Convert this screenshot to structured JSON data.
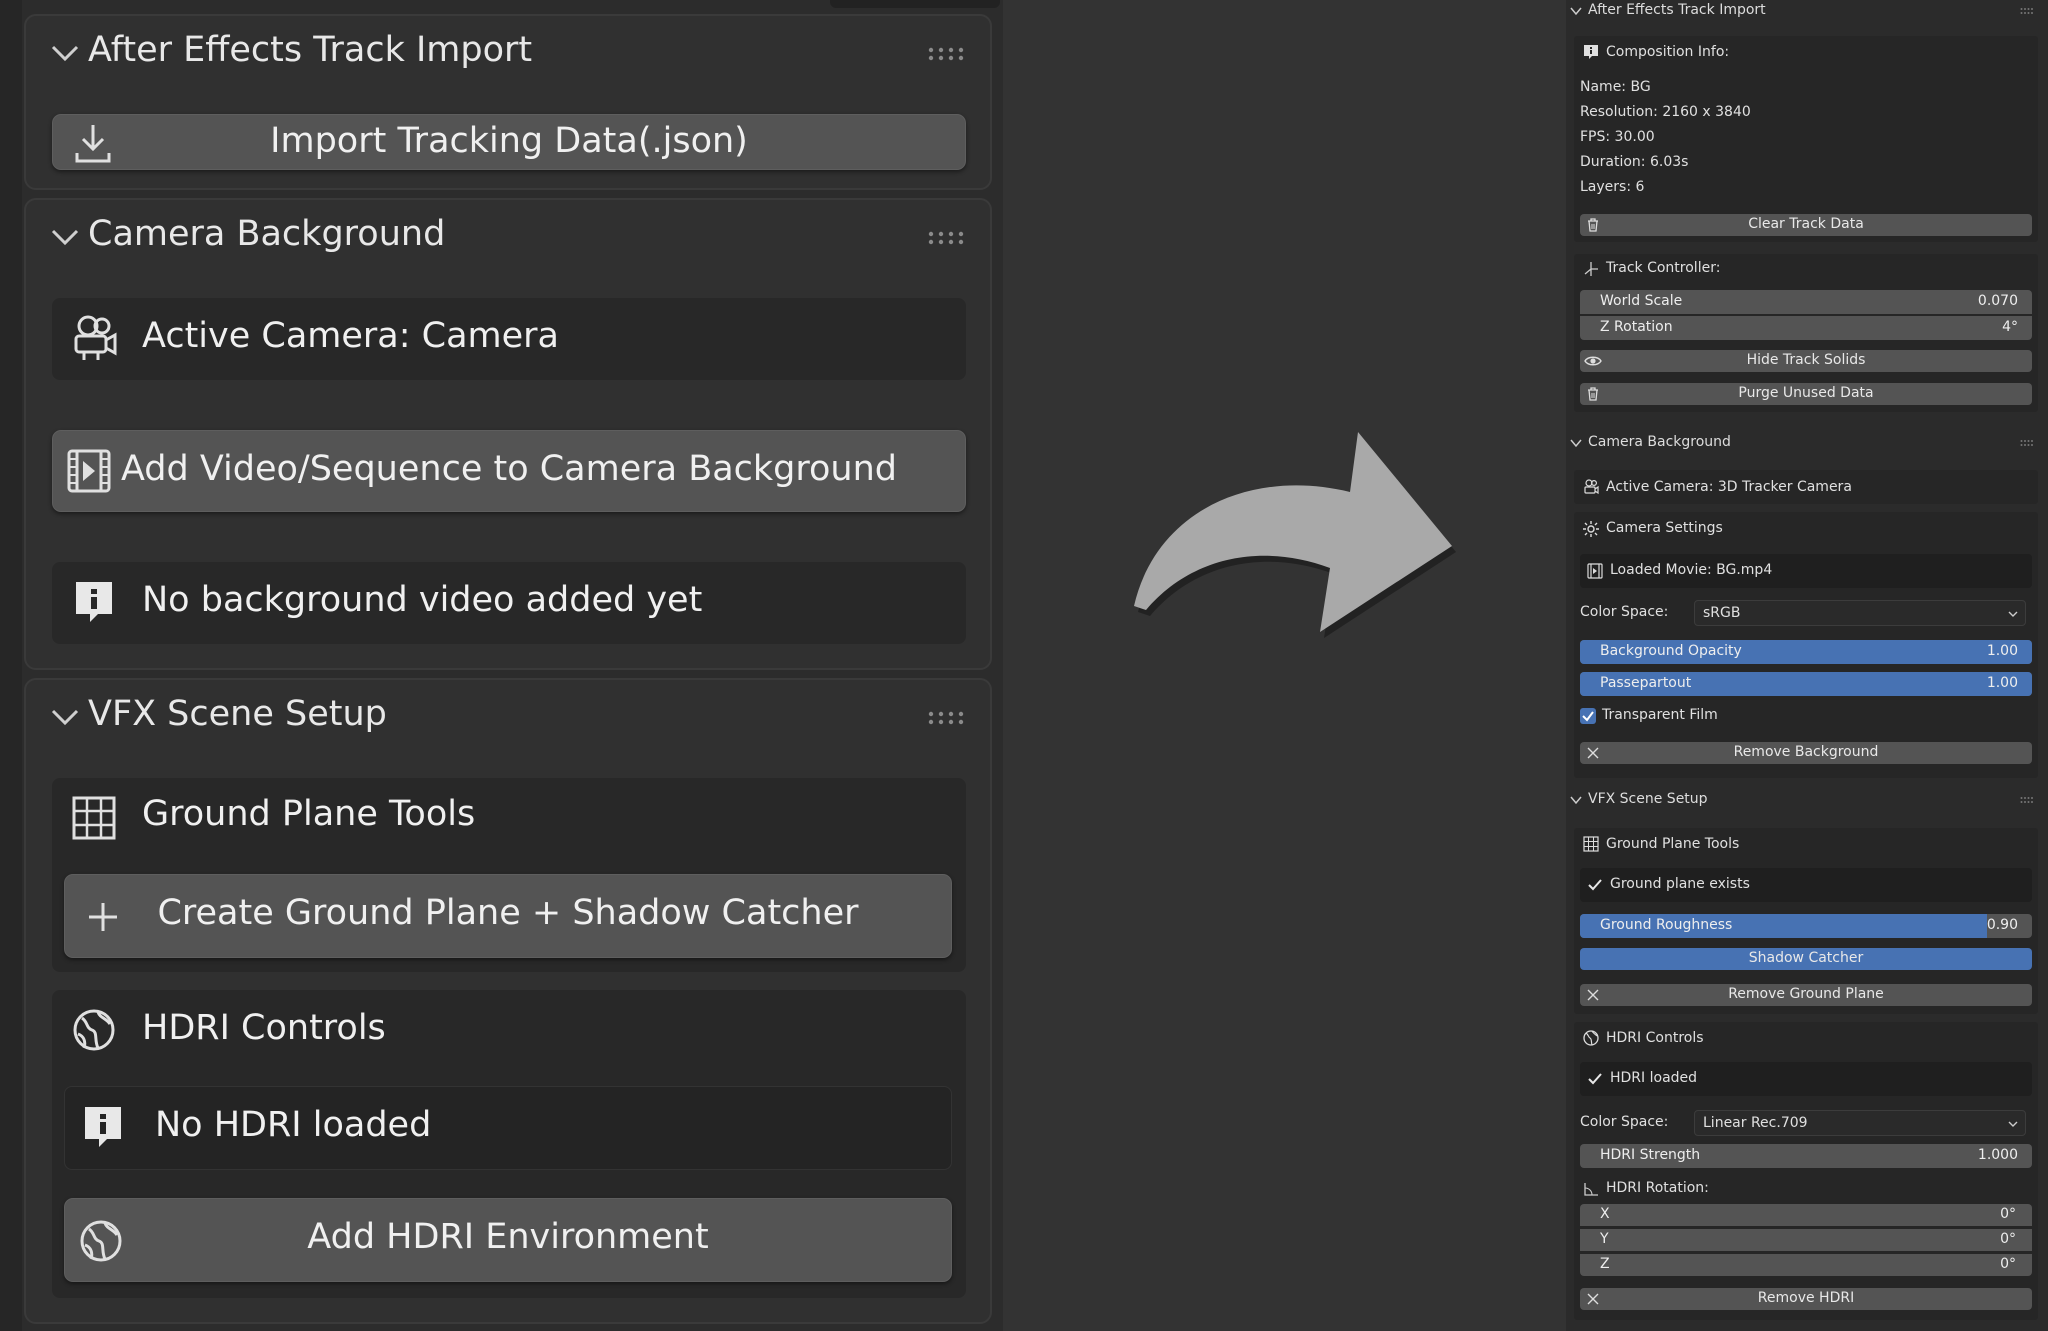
{
  "left": {
    "ae_panel": {
      "title": "After Effects Track Import",
      "import_label": "Import Tracking Data(.json)"
    },
    "cam_panel": {
      "title": "Camera Background",
      "active_camera": "Active Camera: Camera",
      "add_video_label": "Add Video/Sequence to Camera Background",
      "no_video": "No background video added yet"
    },
    "vfx_panel": {
      "title": "VFX Scene Setup",
      "ground_title": "Ground Plane Tools",
      "create_ground_label": "Create Ground Plane + Shadow Catcher",
      "hdri_title": "HDRI Controls",
      "no_hdri": "No HDRI loaded",
      "add_hdri_label": "Add HDRI Environment"
    }
  },
  "right": {
    "ae_panel": {
      "title": "After Effects Track Import",
      "comp_info_label": "Composition Info:",
      "name": "Name: BG",
      "resolution": "Resolution: 2160 x 3840",
      "fps": "FPS: 30.00",
      "duration": "Duration: 6.03s",
      "layers": "Layers: 6",
      "clear_label": "Clear Track Data",
      "track_controller_label": "Track Controller:",
      "world_scale_label": "World Scale",
      "world_scale_value": "0.070",
      "z_rotation_label": "Z Rotation",
      "z_rotation_value": "4°",
      "hide_solids_label": "Hide Track Solids",
      "purge_label": "Purge Unused Data"
    },
    "cam_panel": {
      "title": "Camera Background",
      "active_camera": "Active Camera: 3D Tracker Camera",
      "camera_settings": "Camera Settings",
      "loaded_movie": "Loaded Movie: BG.mp4",
      "color_space_label": "Color Space:",
      "color_space_value": "sRGB",
      "bg_opacity_label": "Background Opacity",
      "bg_opacity_value": "1.00",
      "bg_opacity_fraction": 1.0,
      "passepartout_label": "Passepartout",
      "passepartout_value": "1.00",
      "passepartout_fraction": 1.0,
      "transparent_film_label": "Transparent Film",
      "transparent_film_checked": true,
      "remove_bg_label": "Remove Background"
    },
    "vfx_panel": {
      "title": "VFX Scene Setup",
      "ground_title": "Ground Plane Tools",
      "ground_exists": "Ground plane exists",
      "roughness_label": "Ground Roughness",
      "roughness_value": "0.90",
      "roughness_fraction": 0.9,
      "shadow_catcher_label": "Shadow Catcher",
      "remove_ground_label": "Remove Ground Plane",
      "hdri_title": "HDRI Controls",
      "hdri_loaded": "HDRI loaded",
      "hdri_color_space_label": "Color Space:",
      "hdri_color_space_value": "Linear Rec.709",
      "hdri_strength_label": "HDRI Strength",
      "hdri_strength_value": "1.000",
      "hdri_rotation_label": "HDRI Rotation:",
      "rot_x_label": "X",
      "rot_x_value": "0°",
      "rot_y_label": "Y",
      "rot_y_value": "0°",
      "rot_z_label": "Z",
      "rot_z_value": "0°",
      "remove_hdri_label": "Remove HDRI"
    }
  },
  "colors": {
    "accent": "#4772b3",
    "panel": "#303030",
    "button": "#545454",
    "arrow": "#aaaaaa"
  }
}
